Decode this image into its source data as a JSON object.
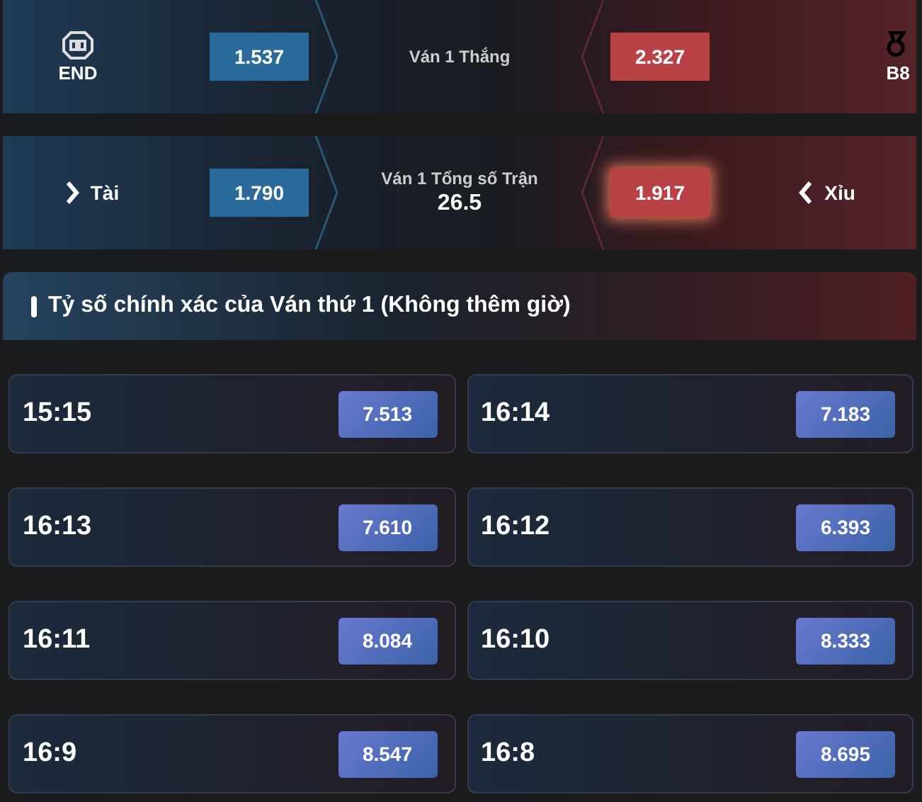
{
  "markets": [
    {
      "kind": "team",
      "left": {
        "label": "END",
        "odds": "1.537",
        "selected": false
      },
      "title": "Ván 1 Thắng",
      "right": {
        "label": "B8",
        "odds": "2.327",
        "selected": false
      }
    },
    {
      "kind": "total",
      "left": {
        "label": "Tài",
        "odds": "1.790",
        "selected": false
      },
      "title": "Ván 1 Tổng số Trận",
      "line": "26.5",
      "right": {
        "label": "Xỉu",
        "odds": "1.917",
        "selected": true
      }
    }
  ],
  "section": {
    "title": "Tỷ số chính xác của Ván thứ 1 (Không thêm giờ)",
    "scores": [
      {
        "score": "15:15",
        "odds": "7.513"
      },
      {
        "score": "16:14",
        "odds": "7.183"
      },
      {
        "score": "16:13",
        "odds": "7.610"
      },
      {
        "score": "16:12",
        "odds": "6.393"
      },
      {
        "score": "16:11",
        "odds": "8.084"
      },
      {
        "score": "16:10",
        "odds": "8.333"
      },
      {
        "score": "16:9",
        "odds": "8.547"
      },
      {
        "score": "16:8",
        "odds": "8.695"
      }
    ]
  }
}
